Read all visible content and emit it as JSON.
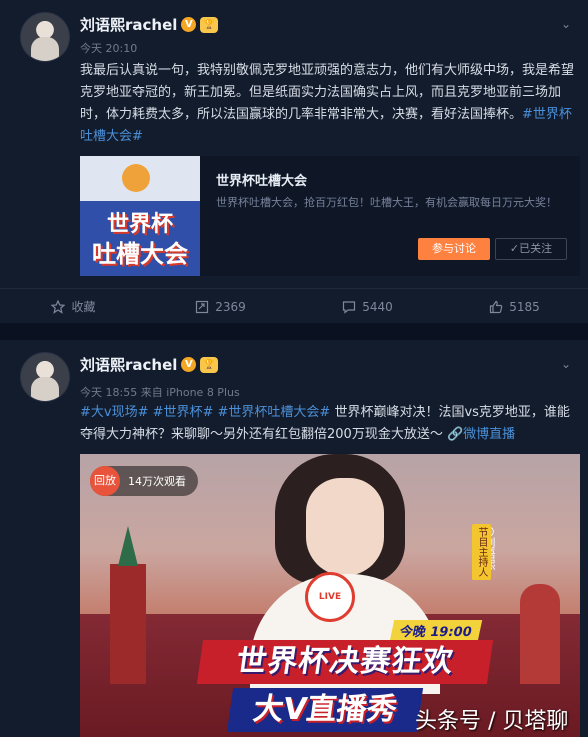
{
  "post1": {
    "author": "刘语熙rachel",
    "badge": "V",
    "badge2": "🏆",
    "time": "今天 20:10",
    "body": "我最后认真说一句，我特别敬佩克罗地亚顽强的意志力，他们有大师级中场，我是希望克罗地亚夺冠的，新王加冕。但是纸面实力法国确实占上风，而且克罗地亚前三场加时，体力耗费太多，所以法国赢球的几率非常非常大，决赛，看好法国捧杯。",
    "hashtag": "#世界杯吐槽大会#",
    "card": {
      "img_line1": "世界杯",
      "img_line2": "吐槽大会",
      "title": "世界杯吐槽大会",
      "desc": "世界杯吐槽大会，抢百万红包！吐槽大王，有机会赢取每日万元大奖！",
      "join_label": "参与讨论",
      "follow_label": "✓已关注"
    },
    "actions": {
      "fav": "收藏",
      "repost": "2369",
      "comment": "5440",
      "like": "5185"
    }
  },
  "post2": {
    "author": "刘语熙rachel",
    "badge": "V",
    "badge2": "🏆",
    "time": "今天 18:55 来自 iPhone 8 Plus",
    "tags_prefix": "#大v现场# #世界杯# #世界杯吐槽大会#",
    "body": " 世界杯巅峰对决！法国vs克罗地亚，谁能夺得大力神杯？来聊聊～另外还有红包翻倍200万现金大放送～",
    "live_link": "🔗微博直播",
    "video": {
      "replay_label": "回放",
      "views": "14万次观看",
      "live_label": "LIVE",
      "host_name": "@刘语熙rachel",
      "host_role": "节目主持人",
      "time_label": "今晚 19:00",
      "line1": "世界杯决赛狂欢",
      "line2": "大V直播秀",
      "watermark": "头条号 / 贝塔聊体育"
    }
  },
  "colors": {
    "accent_link": "#4a90d9",
    "join_button": "#ff8140",
    "background": "#131c2c"
  }
}
